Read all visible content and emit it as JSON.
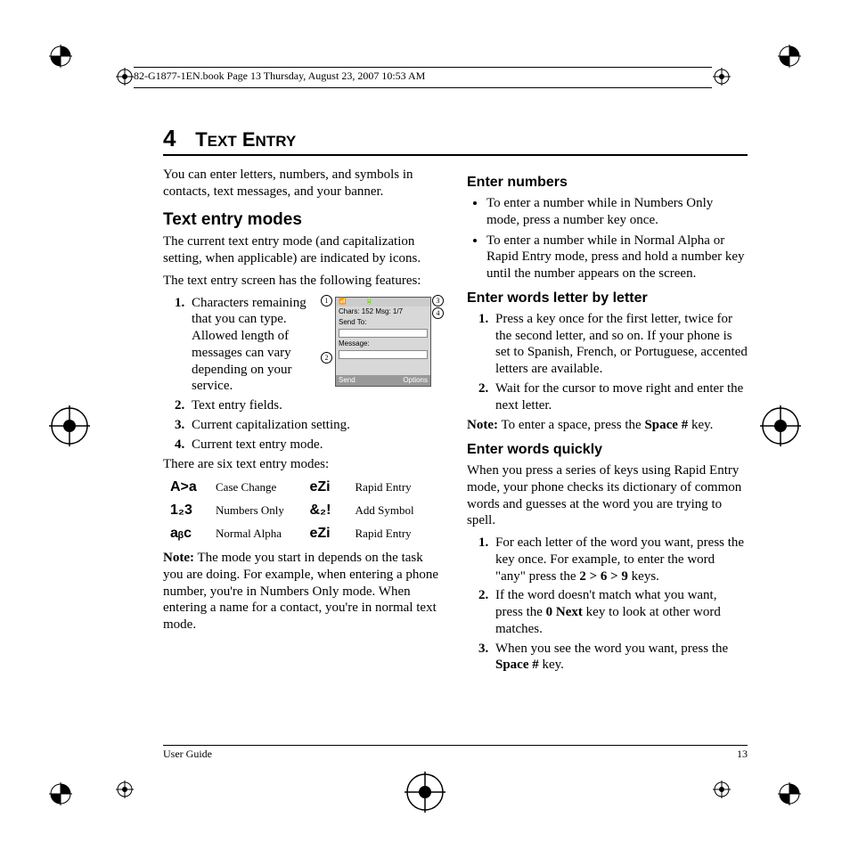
{
  "meta": {
    "header_text": "82-G1877-1EN.book  Page 13  Thursday, August 23, 2007  10:53 AM"
  },
  "chapter": {
    "number": "4",
    "title": "Text Entry"
  },
  "left": {
    "intro": "You can enter letters, numbers, and symbols in contacts, text messages, and your banner.",
    "h_modes": "Text entry modes",
    "modes_p1": "The current text entry mode (and capitalization setting, when applicable) are indicated by icons.",
    "modes_p2": "The text entry screen has the following features:",
    "feat1": "Characters remaining that you can type. Allowed length of messages can vary depending on your service.",
    "feat2": "Text entry fields.",
    "feat3": "Current capitalization setting.",
    "feat4": "Current text entry mode.",
    "six_modes": "There are six text entry modes:",
    "modes": {
      "case_icon": "A>a",
      "case_label": "Case Change",
      "num_icon": "1₂3",
      "num_label": "Numbers Only",
      "alpha_icon": "aᵦc",
      "alpha_label": "Normal Alpha",
      "rapid_icon": "eZi",
      "rapid_label": "Rapid Entry",
      "sym_icon": "&₂!",
      "sym_label": "Add Symbol",
      "rapid2_icon": "eZi",
      "rapid2_label": "Rapid Entry"
    },
    "note_label": "Note:",
    "note_text": " The mode you start in depends on the task you are doing. For example, when entering a phone number, you're in Numbers Only mode. When entering a name for a contact, you're in normal text mode."
  },
  "screenshot": {
    "status_chars": "Chars: 152   Msg: 1/7",
    "send_to": "Send To:",
    "message": "Message:",
    "softkey_left": "Send",
    "softkey_right": "Options",
    "c1": "1",
    "c2": "2",
    "c3": "3",
    "c4": "4"
  },
  "right": {
    "h_nums": "Enter numbers",
    "nums_b1": "To enter a number while in Numbers Only mode, press a number key once.",
    "nums_b2": "To enter a number while in Normal Alpha or Rapid Entry mode, press and hold a number key until the number appears on the screen.",
    "h_letter": "Enter words letter by letter",
    "letter_1": "Press a key once for the first letter, twice for the second letter, and so on. If your phone is set to Spanish, French, or Portuguese, accented letters are available.",
    "letter_2": "Wait for the cursor to move right and enter the next letter.",
    "letter_note_label": "Note:",
    "letter_note_a": " To enter a space, press the ",
    "letter_note_key": "Space #",
    "letter_note_b": " key.",
    "h_quick": "Enter words quickly",
    "quick_intro": "When you press a series of keys using Rapid Entry mode, your phone checks its dictionary of common words and guesses at the word you are trying to spell.",
    "quick_1a": "For each letter of the word you want, press the key once. For example, to enter the word \"any\" press the ",
    "quick_1_keys": "2 > 6 > 9",
    "quick_1b": " keys.",
    "quick_2a": "If the word doesn't match what you want, press the ",
    "quick_2_key": "0 Next",
    "quick_2b": " key to look at other word matches.",
    "quick_3a": "When you see the word you want, press the ",
    "quick_3_key": "Space #",
    "quick_3b": " key."
  },
  "footer": {
    "left": "User Guide",
    "right": "13"
  }
}
